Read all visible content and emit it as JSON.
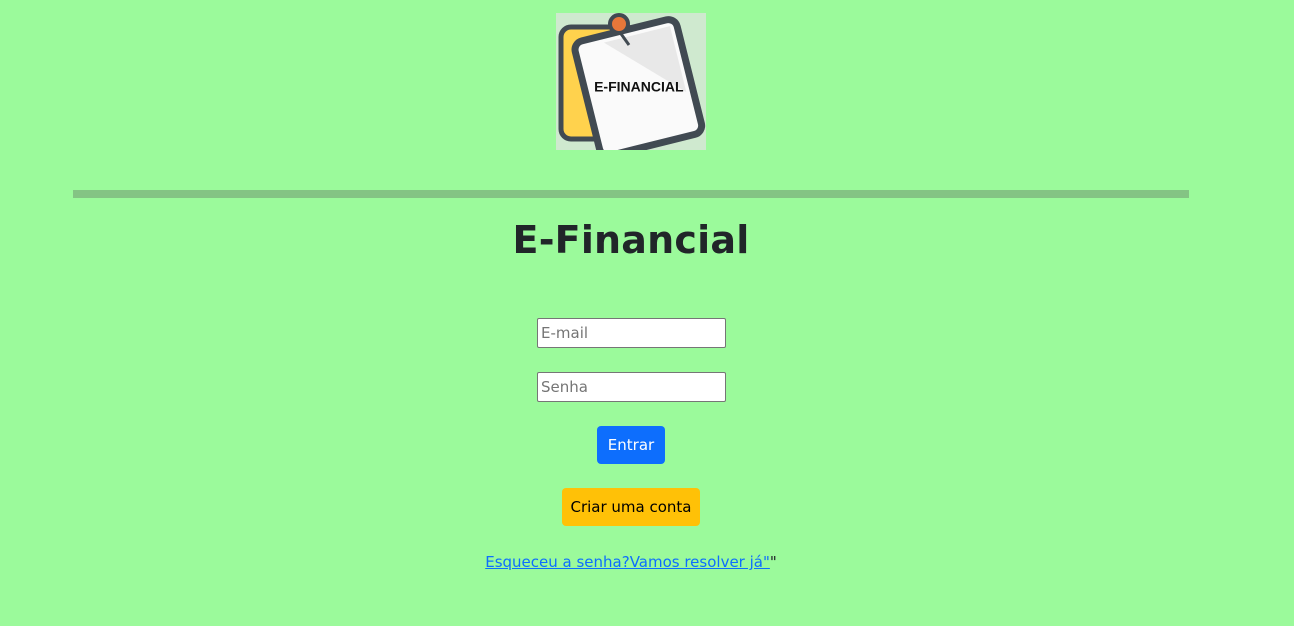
{
  "app": {
    "logo_text": "E-FINANCIAL",
    "title": "E-Financial"
  },
  "login_form": {
    "email_placeholder": "E-mail",
    "password_placeholder": "Senha",
    "login_label": "Entrar",
    "signup_label": "Criar uma conta",
    "forgot_link_label": "Esqueceu a senha?Vamos resolver já\"",
    "forgot_trailing_text": "\""
  },
  "colors": {
    "background": "#9bfa9b",
    "divider": "#84c484",
    "primary_button": "#0d6efd",
    "warning_button": "#ffc107",
    "link": "#0d6efd",
    "logo_note_yellow": "#ffd24d",
    "logo_pin": "#e8773a"
  },
  "icons": {
    "logo": "sticky-note-logo"
  }
}
